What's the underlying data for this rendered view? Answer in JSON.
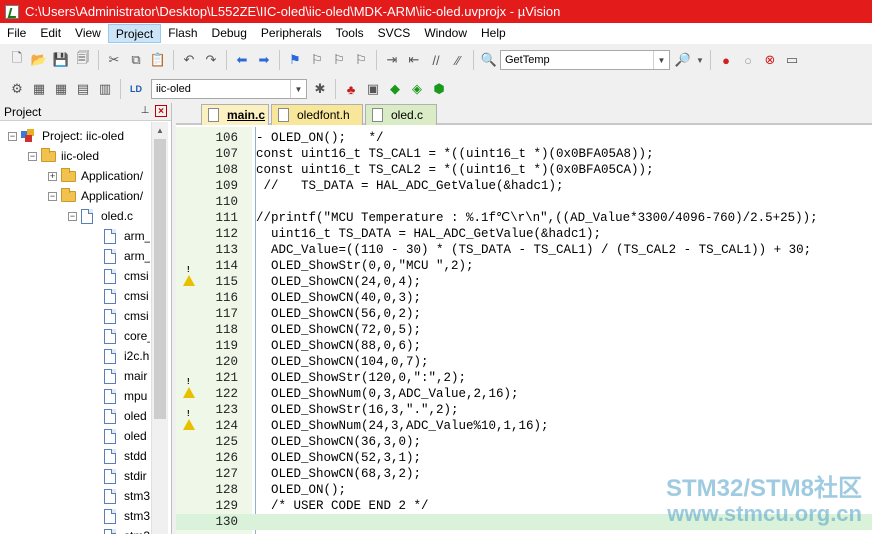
{
  "window": {
    "title": "C:\\Users\\Administrator\\Desktop\\L552ZE\\IIC-oled\\iic-oled\\MDK-ARM\\iic-oled.uvprojx - µVision"
  },
  "menu": [
    "File",
    "Edit",
    "View",
    "Project",
    "Flash",
    "Debug",
    "Peripherals",
    "Tools",
    "SVCS",
    "Window",
    "Help"
  ],
  "toolbar": {
    "function_combo": "GetTemp",
    "target_combo": "iic-oled"
  },
  "project": {
    "header": "Project",
    "tree": [
      {
        "label": "Project: iic-oled",
        "level": 0,
        "kind": "project",
        "expander": "−"
      },
      {
        "label": "iic-oled",
        "level": 1,
        "kind": "folder",
        "expander": "−"
      },
      {
        "label": "Application/",
        "level": 2,
        "kind": "folder",
        "expander": "+"
      },
      {
        "label": "Application/",
        "level": 2,
        "kind": "folder",
        "expander": "−"
      },
      {
        "label": "oled.c",
        "level": 3,
        "kind": "file",
        "expander": "−"
      },
      {
        "label": "arm_",
        "level": 4,
        "kind": "file"
      },
      {
        "label": "arm_",
        "level": 4,
        "kind": "file"
      },
      {
        "label": "cmsi",
        "level": 4,
        "kind": "file"
      },
      {
        "label": "cmsi",
        "level": 4,
        "kind": "file"
      },
      {
        "label": "cmsi",
        "level": 4,
        "kind": "file"
      },
      {
        "label": "core_",
        "level": 4,
        "kind": "file"
      },
      {
        "label": "i2c.h",
        "level": 4,
        "kind": "file"
      },
      {
        "label": "mair",
        "level": 4,
        "kind": "file"
      },
      {
        "label": "mpu",
        "level": 4,
        "kind": "file"
      },
      {
        "label": "oled",
        "level": 4,
        "kind": "file"
      },
      {
        "label": "oled",
        "level": 4,
        "kind": "file"
      },
      {
        "label": "stdd",
        "level": 4,
        "kind": "file"
      },
      {
        "label": "stdir",
        "level": 4,
        "kind": "file"
      },
      {
        "label": "stm3",
        "level": 4,
        "kind": "file"
      },
      {
        "label": "stm3",
        "level": 4,
        "kind": "file"
      },
      {
        "label": "stm3",
        "level": 4,
        "kind": "file"
      }
    ]
  },
  "tabs": [
    {
      "label": "main.c",
      "active": true
    },
    {
      "label": "oledfont.h",
      "active": false
    },
    {
      "label": "oled.c",
      "active": false
    }
  ],
  "code": [
    {
      "num": "106",
      "text": "- OLED_ON();   */",
      "style": "cmt",
      "warn": false
    },
    {
      "num": "107",
      "text": "const uint16_t TS_CAL1 = *((uint16_t *)(0x0BFA05A8));",
      "style": "kw",
      "warn": false
    },
    {
      "num": "108",
      "text": "const uint16_t TS_CAL2 = *((uint16_t *)(0x0BFA05CA));",
      "style": "kw",
      "warn": false
    },
    {
      "num": "109",
      "text": " //   TS_DATA = HAL_ADC_GetValue(&hadc1);",
      "style": "cmt",
      "warn": false
    },
    {
      "num": "110",
      "text": "",
      "style": "",
      "warn": false
    },
    {
      "num": "111",
      "text": "//printf(\"MCU Temperature : %.1f℃\\r\\n\",((AD_Value*3300/4096-760)/2.5+25));",
      "style": "cmt",
      "warn": false
    },
    {
      "num": "112",
      "text": "  uint16_t TS_DATA = HAL_ADC_GetValue(&hadc1);",
      "style": "",
      "warn": false
    },
    {
      "num": "113",
      "text": "  ADC_Value=((110 - 30) * (TS_DATA - TS_CAL1) / (TS_CAL2 - TS_CAL1)) + 30;",
      "style": "",
      "warn": false
    },
    {
      "num": "114",
      "text": "  OLED_ShowStr(0,0,\"MCU \",2);",
      "style": "",
      "warn": true
    },
    {
      "num": "115",
      "text": "  OLED_ShowCN(24,0,4);",
      "style": "",
      "warn": false
    },
    {
      "num": "116",
      "text": "  OLED_ShowCN(40,0,3);",
      "style": "",
      "warn": false
    },
    {
      "num": "117",
      "text": "  OLED_ShowCN(56,0,2);",
      "style": "",
      "warn": false
    },
    {
      "num": "118",
      "text": "  OLED_ShowCN(72,0,5);",
      "style": "",
      "warn": false
    },
    {
      "num": "119",
      "text": "  OLED_ShowCN(88,0,6);",
      "style": "",
      "warn": false
    },
    {
      "num": "120",
      "text": "  OLED_ShowCN(104,0,7);",
      "style": "",
      "warn": false
    },
    {
      "num": "121",
      "text": "  OLED_ShowStr(120,0,\":\",2);",
      "style": "",
      "warn": true
    },
    {
      "num": "122",
      "text": "  OLED_ShowNum(0,3,ADC_Value,2,16);",
      "style": "",
      "warn": false
    },
    {
      "num": "123",
      "text": "  OLED_ShowStr(16,3,\".\",2);",
      "style": "",
      "warn": true
    },
    {
      "num": "124",
      "text": "  OLED_ShowNum(24,3,ADC_Value%10,1,16);",
      "style": "",
      "warn": false
    },
    {
      "num": "125",
      "text": "  OLED_ShowCN(36,3,0);",
      "style": "",
      "warn": false
    },
    {
      "num": "126",
      "text": "  OLED_ShowCN(52,3,1);",
      "style": "",
      "warn": false
    },
    {
      "num": "127",
      "text": "  OLED_ShowCN(68,3,2);",
      "style": "",
      "warn": false
    },
    {
      "num": "128",
      "text": "  OLED_ON();",
      "style": "",
      "warn": false
    },
    {
      "num": "129",
      "text": "  /* USER CODE END 2 */",
      "style": "cmt",
      "warn": false
    },
    {
      "num": "130",
      "text": "",
      "style": "",
      "warn": false,
      "current": true
    }
  ],
  "watermark": {
    "line1": "STM32/STM8社区",
    "line2": "www.stmcu.org.cn"
  }
}
